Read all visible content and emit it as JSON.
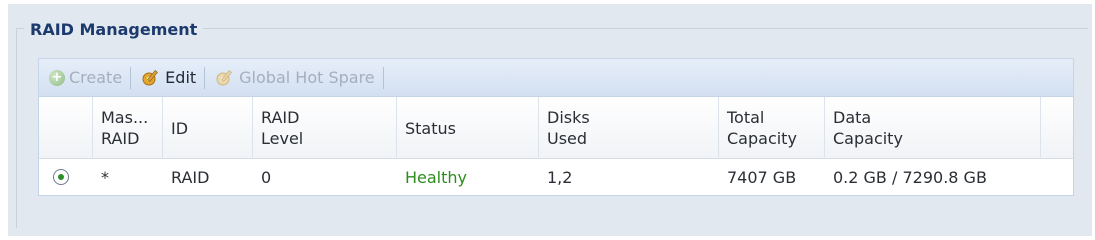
{
  "panel": {
    "title": "RAID Management"
  },
  "toolbar": {
    "create_label": "Create",
    "edit_label": "Edit",
    "hot_spare_label": "Global Hot Spare"
  },
  "table": {
    "columns": [
      "Mas... RAID",
      "ID",
      "RAID Level",
      "Status",
      "Disks Used",
      "Total Capacity",
      "Data Capacity"
    ],
    "column_lines": [
      [
        "Mas...",
        "RAID"
      ],
      [
        "ID"
      ],
      [
        "RAID",
        "Level"
      ],
      [
        "Status"
      ],
      [
        "Disks",
        "Used"
      ],
      [
        "Total",
        "Capacity"
      ],
      [
        "Data",
        "Capacity"
      ]
    ],
    "rows": [
      {
        "selected": true,
        "master": "*",
        "id": "RAID",
        "level": "0",
        "status": "Healthy",
        "disks": "1,2",
        "total": "7407 GB",
        "data": "0.2 GB / 7290.8 GB"
      }
    ]
  },
  "colors": {
    "healthy": "#2e8b1e",
    "title": "#1c3a6e"
  },
  "icons": {
    "create": "add-circle-icon",
    "edit": "gear-pencil-icon",
    "hot_spare": "gear-pencil-icon"
  }
}
